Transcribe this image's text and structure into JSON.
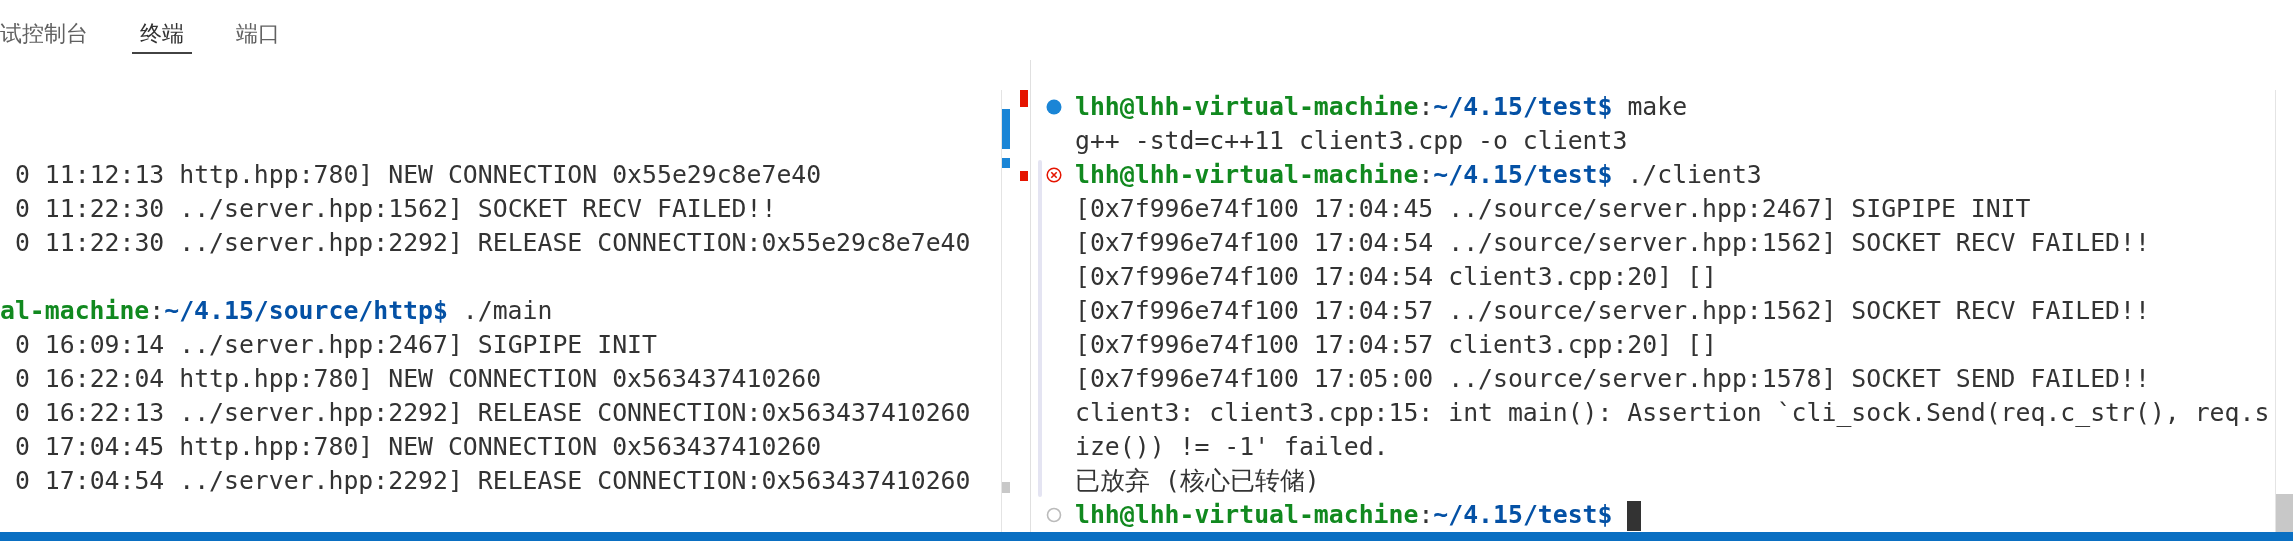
{
  "tabs": [
    {
      "label": "试控制台",
      "selected": false
    },
    {
      "label": "终端",
      "selected": true
    },
    {
      "label": "端口",
      "selected": false
    }
  ],
  "left_terminal": {
    "lines": [
      {
        "kind": "output",
        "text": "0 11:12:13 http.hpp:780] NEW CONNECTION 0x55e29c8e7e40"
      },
      {
        "kind": "output",
        "text": "0 11:22:30 ../server.hpp:1562] SOCKET RECV FAILED!!"
      },
      {
        "kind": "output",
        "text": "0 11:22:30 ../server.hpp:2292] RELEASE CONNECTION:0x55e29c8e7e40"
      },
      {
        "kind": "blank"
      },
      {
        "kind": "prompt",
        "user": "al-machine",
        "colon": ":",
        "path": "~/4.15/source/http$",
        "command": "./main",
        "cursor": false
      },
      {
        "kind": "output",
        "text": "0 16:09:14 ../server.hpp:2467] SIGPIPE INIT"
      },
      {
        "kind": "output",
        "text": "0 16:22:04 http.hpp:780] NEW CONNECTION 0x563437410260"
      },
      {
        "kind": "output",
        "text": "0 16:22:13 ../server.hpp:2292] RELEASE CONNECTION:0x563437410260"
      },
      {
        "kind": "output",
        "text": "0 17:04:45 http.hpp:780] NEW CONNECTION 0x563437410260"
      },
      {
        "kind": "output",
        "text": "0 17:04:54 ../server.hpp:2292] RELEASE CONNECTION:0x563437410260"
      }
    ]
  },
  "right_terminal": {
    "lines": [
      {
        "kind": "prompt",
        "decoration": {
          "kind": "success"
        },
        "user": "lhh@lhh-virtual-machine",
        "colon": ":",
        "path": "~/4.15/test$",
        "command": "make",
        "cursor": false
      },
      {
        "kind": "output",
        "text": "g++ -std=c++11 client3.cpp -o client3"
      },
      {
        "kind": "prompt",
        "decoration": {
          "kind": "error"
        },
        "user": "lhh@lhh-virtual-machine",
        "colon": ":",
        "path": "~/4.15/test$",
        "command": "./client3",
        "cursor": false
      },
      {
        "kind": "output",
        "text": "[0x7f996e74f100 17:04:45 ../source/server.hpp:2467] SIGPIPE INIT"
      },
      {
        "kind": "output",
        "text": "[0x7f996e74f100 17:04:54 ../source/server.hpp:1562] SOCKET RECV FAILED!!"
      },
      {
        "kind": "output",
        "text": "[0x7f996e74f100 17:04:54 client3.cpp:20] []"
      },
      {
        "kind": "output",
        "text": "[0x7f996e74f100 17:04:57 ../source/server.hpp:1562] SOCKET RECV FAILED!!"
      },
      {
        "kind": "output",
        "text": "[0x7f996e74f100 17:04:57 client3.cpp:20] []"
      },
      {
        "kind": "output",
        "text": "[0x7f996e74f100 17:05:00 ../source/server.hpp:1578] SOCKET SEND FAILED!!"
      },
      {
        "kind": "output",
        "text": "client3: client3.cpp:15: int main(): Assertion `cli_sock.Send(req.c_str(), req.s"
      },
      {
        "kind": "output",
        "text": "ize()) != -1' failed."
      },
      {
        "kind": "output",
        "text": "已放弃 (核心已转储)"
      },
      {
        "kind": "prompt",
        "decoration": {
          "kind": "pending"
        },
        "user": "lhh@lhh-virtual-machine",
        "colon": ":",
        "path": "~/4.15/test$",
        "cursor": true
      }
    ]
  }
}
